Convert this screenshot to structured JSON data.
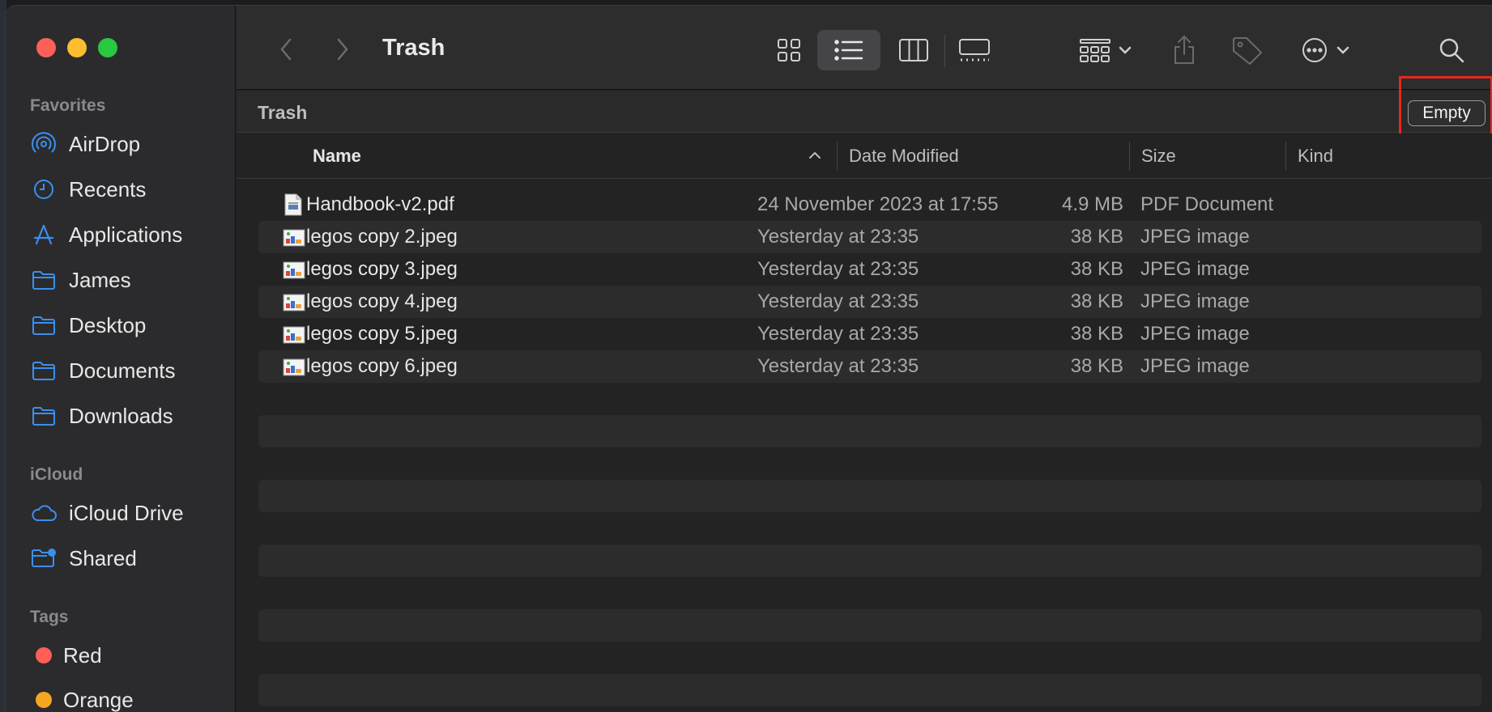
{
  "window": {
    "title": "Trash"
  },
  "sidebar": {
    "favorites_heading": "Favorites",
    "favorites": [
      {
        "label": "AirDrop",
        "icon": "airdrop-icon"
      },
      {
        "label": "Recents",
        "icon": "clock-icon"
      },
      {
        "label": "Applications",
        "icon": "applications-icon"
      },
      {
        "label": "James",
        "icon": "folder-icon"
      },
      {
        "label": "Desktop",
        "icon": "folder-icon"
      },
      {
        "label": "Documents",
        "icon": "folder-icon"
      },
      {
        "label": "Downloads",
        "icon": "folder-icon"
      }
    ],
    "icloud_heading": "iCloud",
    "icloud": [
      {
        "label": "iCloud Drive",
        "icon": "cloud-icon"
      },
      {
        "label": "Shared",
        "icon": "shared-folder-icon"
      }
    ],
    "tags_heading": "Tags",
    "tags": [
      {
        "label": "Red",
        "color": "#fe5f57"
      },
      {
        "label": "Orange",
        "color": "#f5a623"
      }
    ]
  },
  "toolbar": {
    "back_icon": "chevron-left-icon",
    "forward_icon": "chevron-right-icon",
    "view_icons": [
      "icon-view-icon",
      "list-view-icon",
      "column-view-icon",
      "gallery-view-icon"
    ],
    "active_view": "list-view-icon",
    "group_icon": "group-icon",
    "share_icon": "share-icon",
    "tag_icon": "tag-icon",
    "more_icon": "more-icon",
    "search_icon": "search-icon"
  },
  "pathbar": {
    "title": "Trash",
    "empty_label": "Empty"
  },
  "columns": {
    "name": "Name",
    "date": "Date Modified",
    "size": "Size",
    "kind": "Kind"
  },
  "files": [
    {
      "name": "Handbook-v2.pdf",
      "date": "24 November 2023 at 17:55",
      "size": "4.9 MB",
      "kind": "PDF Document",
      "type": "pdf"
    },
    {
      "name": "legos copy 2.jpeg",
      "date": "Yesterday at 23:35",
      "size": "38 KB",
      "kind": "JPEG image",
      "type": "jpeg"
    },
    {
      "name": "legos copy 3.jpeg",
      "date": "Yesterday at 23:35",
      "size": "38 KB",
      "kind": "JPEG image",
      "type": "jpeg"
    },
    {
      "name": "legos copy 4.jpeg",
      "date": "Yesterday at 23:35",
      "size": "38 KB",
      "kind": "JPEG image",
      "type": "jpeg"
    },
    {
      "name": "legos copy 5.jpeg",
      "date": "Yesterday at 23:35",
      "size": "38 KB",
      "kind": "JPEG image",
      "type": "jpeg"
    },
    {
      "name": "legos copy 6.jpeg",
      "date": "Yesterday at 23:35",
      "size": "38 KB",
      "kind": "JPEG image",
      "type": "jpeg"
    }
  ],
  "colors": {
    "accent": "#3b8fef",
    "highlight": "#e8261e"
  }
}
